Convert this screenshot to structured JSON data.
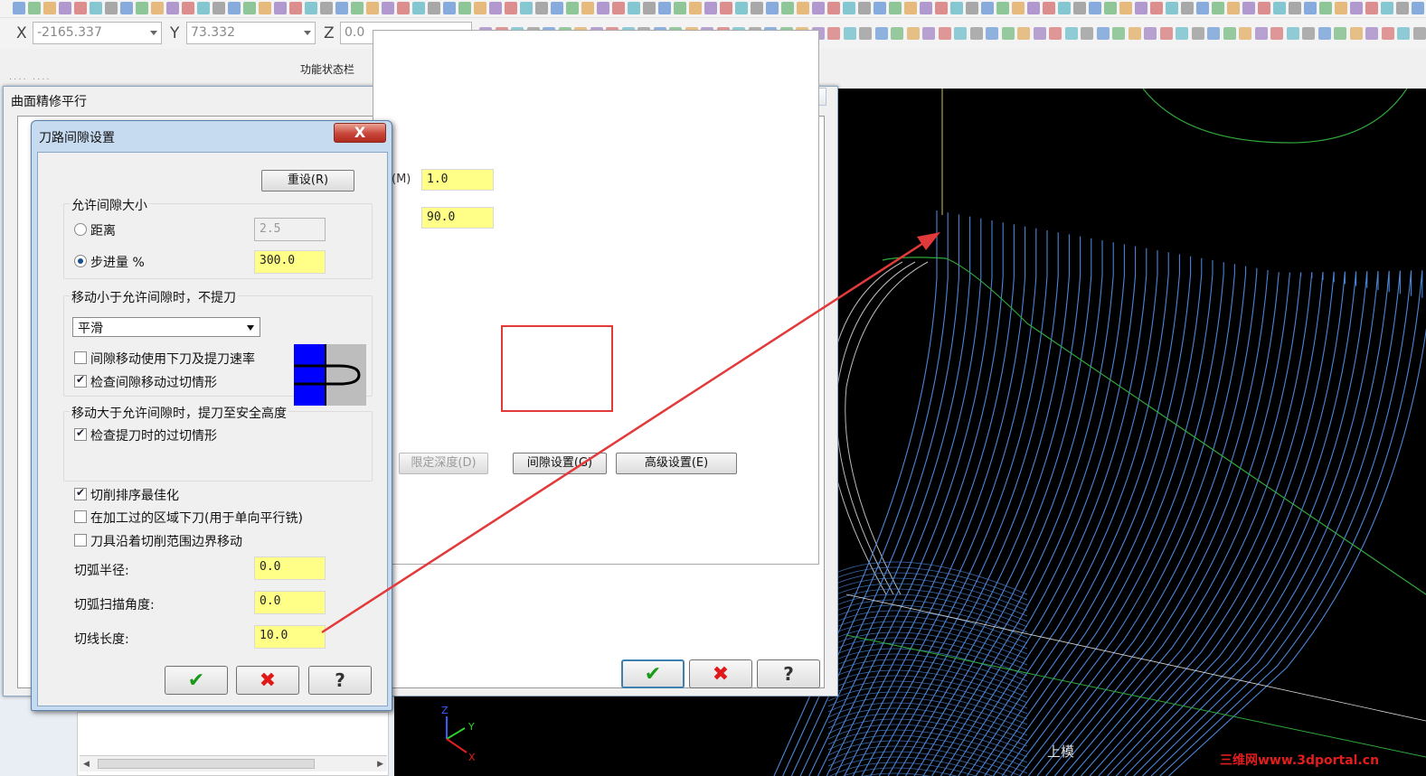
{
  "coords": {
    "x_label": "X",
    "x_value": "-2165.337",
    "y_label": "Y",
    "y_value": "73.332",
    "z_label": "Z",
    "z_value": "0.0"
  },
  "status_bar_caption": "功能状态栏",
  "main_dialog": {
    "title": "曲面精修平行",
    "close_label": "X",
    "tab_hint": "(M)",
    "field1": "1.0",
    "field2": "90.0",
    "limit_depth_button": "限定深度(D)",
    "gap_settings_button": "间隙设置(G)",
    "advanced_button": "高级设置(E)"
  },
  "gap_dialog": {
    "title": "刀路间隙设置",
    "close_label": "X",
    "reset_button": "重设(R)",
    "allowed_gap_group": "允许间隙大小",
    "distance_label": "距离",
    "distance_value": "2.5",
    "stepover_label": "步进量 %",
    "stepover_value": "300.0",
    "small_move_group": "移动小于允许间隙时，不提刀",
    "small_move_select": "平滑",
    "use_plunge_retract_rate": "间隙移动使用下刀及提刀速率",
    "check_gap_gouge": "检查间隙移动过切情形",
    "large_move_group": "移动大于允许间隙时，提刀至安全高度",
    "check_retract_gouge": "检查提刀时的过切情形",
    "optimize_cut_order": "切削排序最佳化",
    "plunge_in_machined_area": "在加工过的区域下刀(用于单向平行铣)",
    "tool_follow_boundary": "刀具沿着切削范围边界移动",
    "arc_radius_label": "切弧半径:",
    "arc_radius_value": "0.0",
    "arc_sweep_label": "切弧扫描角度:",
    "arc_sweep_value": "0.0",
    "line_length_label": "切线长度:",
    "line_length_value": "10.0"
  },
  "viewport": {
    "view_label": "上模",
    "watermark": "三维网www.3dportal.cn",
    "axis_x": "X",
    "axis_y": "Y",
    "axis_z": "Z"
  },
  "state": {
    "distance_radio": false,
    "stepover_radio": true,
    "use_plunge_retract_rate": false,
    "check_gap_gouge": true,
    "check_retract_gouge": true,
    "optimize_cut_order": true,
    "plunge_in_machined_area": false,
    "tool_follow_boundary": false
  },
  "colors": {
    "toolpath": "#4a86d8",
    "highlight": "#e23a3a",
    "field_yellow": "#ffff88",
    "viewport_bg": "#000000"
  }
}
